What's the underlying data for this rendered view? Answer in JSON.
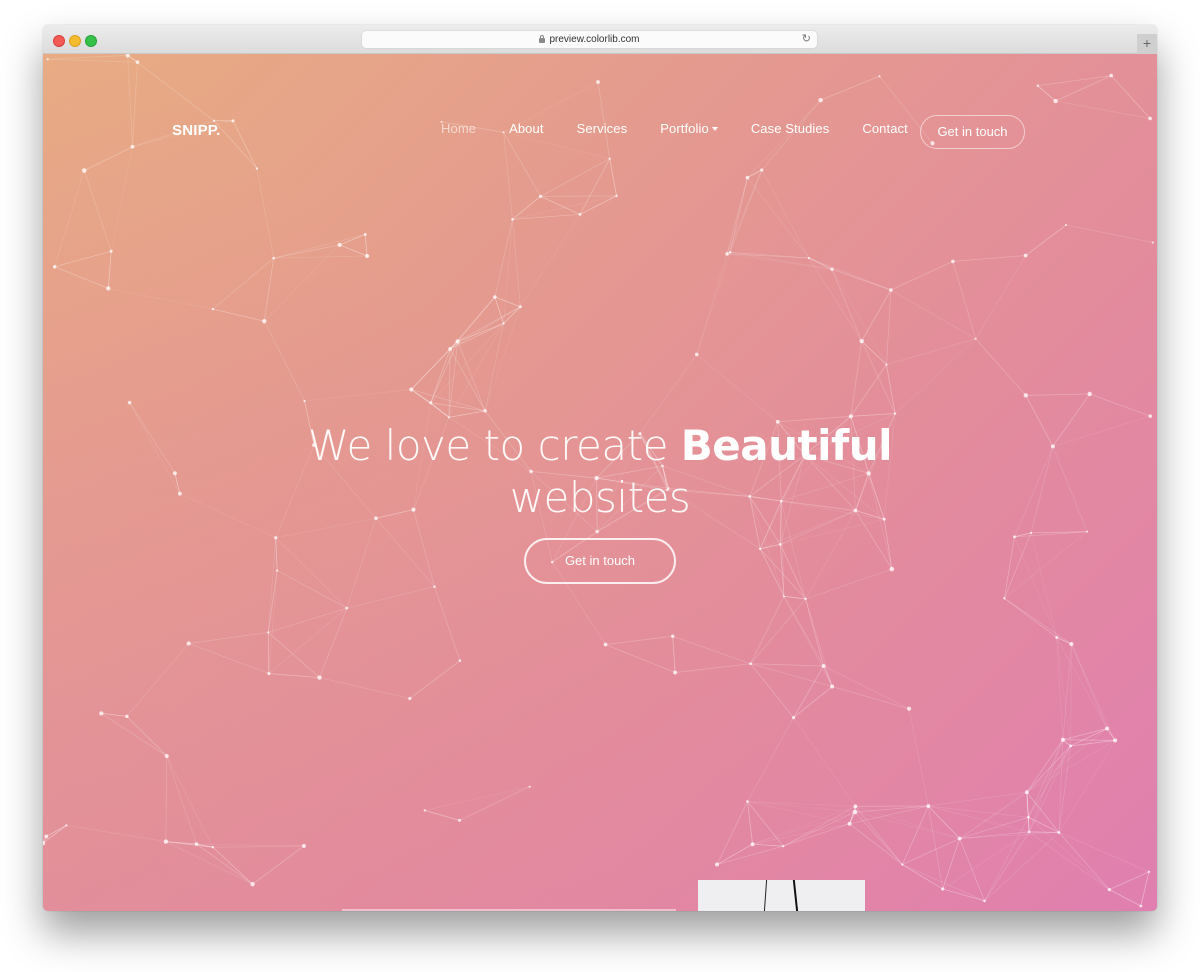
{
  "browser": {
    "url": "preview.colorlib.com",
    "new_tab_label": "+",
    "reload_icon": "↻"
  },
  "site": {
    "logo": "SNIPP.",
    "nav": [
      {
        "label": "Home",
        "active": true
      },
      {
        "label": "About"
      },
      {
        "label": "Services"
      },
      {
        "label": "Portfolio",
        "has_dropdown": true
      },
      {
        "label": "Case Studies"
      },
      {
        "label": "Contact"
      }
    ],
    "nav_cta": "Get in touch"
  },
  "hero": {
    "title_light": "We love to create ",
    "title_bold": "Beautiful",
    "title_line2": "websites",
    "cta": "Get in touch"
  },
  "colors": {
    "gradient_start": "#e8ad82",
    "gradient_end": "#e07fb0",
    "text": "#ffffff"
  }
}
